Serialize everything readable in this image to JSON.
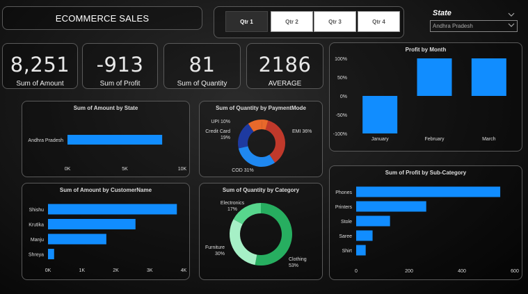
{
  "header": {
    "title": "ECOMMERCE SALES"
  },
  "quarters": {
    "tabs": [
      "Qtr 1",
      "Qtr 2",
      "Qtr 3",
      "Qtr 4"
    ],
    "active": 0
  },
  "state_slicer": {
    "title": "State",
    "selected": "Andhra Pradesh"
  },
  "kpis": [
    {
      "value": "8,251",
      "label": "Sum of Amount"
    },
    {
      "value": "-913",
      "label": "Sum of Profit"
    },
    {
      "value": "81",
      "label": "Sum of Quantity"
    },
    {
      "value": "2186",
      "label": "AVERAGE"
    }
  ],
  "colors": {
    "bar": "#118DFF",
    "emi": "#C0392B",
    "cod": "#1F88F0",
    "credit_card": "#1E3AA0",
    "upi": "#E8692B",
    "clothing": "#27AE60",
    "furniture": "#A6F0C6",
    "electronics": "#58D68D"
  },
  "chart_data": [
    {
      "type": "bar",
      "orientation": "horizontal",
      "title": "Sum of Amount by State",
      "categories": [
        "Andhra Pradesh"
      ],
      "values": [
        8251
      ],
      "xlim": [
        0,
        10000
      ],
      "xticks": [
        "0K",
        "5K",
        "10K"
      ]
    },
    {
      "type": "pie",
      "subtype": "donut",
      "title": "Sum of Quantity by PaymentMode",
      "slices": [
        {
          "label": "EMI",
          "pct_label": "36%",
          "value": 36
        },
        {
          "label": "COD",
          "pct_label": "31%",
          "value": 31
        },
        {
          "label": "Credit Card",
          "pct_label": "19%",
          "value": 19
        },
        {
          "label": "UPI",
          "pct_label": "10%",
          "value": 10
        },
        {
          "label": "",
          "pct_label": "",
          "value": 4
        }
      ]
    },
    {
      "type": "bar",
      "title": "Profit by Month",
      "categories": [
        "January",
        "February",
        "March"
      ],
      "values": [
        -1,
        1,
        1
      ],
      "ylim": [
        -1,
        1
      ],
      "yticks": [
        "100%",
        "50%",
        "0%",
        "-50%",
        "-100%"
      ]
    },
    {
      "type": "bar",
      "orientation": "horizontal",
      "title": "Sum of Amount by CustomerName",
      "categories": [
        "Shishu",
        "Krutika",
        "Manju",
        "Shreya"
      ],
      "values": [
        3800,
        2580,
        1720,
        180
      ],
      "xlim": [
        0,
        4000
      ],
      "xticks": [
        "0K",
        "1K",
        "2K",
        "3K",
        "4K"
      ]
    },
    {
      "type": "pie",
      "subtype": "donut",
      "title": "Sum of Quantity by Category",
      "slices": [
        {
          "label": "Clothing",
          "pct_label": "53%",
          "value": 53
        },
        {
          "label": "Furniture",
          "pct_label": "30%",
          "value": 30
        },
        {
          "label": "Electronics",
          "pct_label": "17%",
          "value": 17
        }
      ]
    },
    {
      "type": "bar",
      "orientation": "horizontal",
      "title": "Sum of Profit by Sub-Category",
      "categories": [
        "Phones",
        "Printers",
        "Stole",
        "Saree",
        "Shirt"
      ],
      "values": [
        545,
        265,
        128,
        62,
        36
      ],
      "xlim": [
        0,
        600
      ],
      "xticks": [
        "0",
        "200",
        "400",
        "600"
      ]
    }
  ]
}
